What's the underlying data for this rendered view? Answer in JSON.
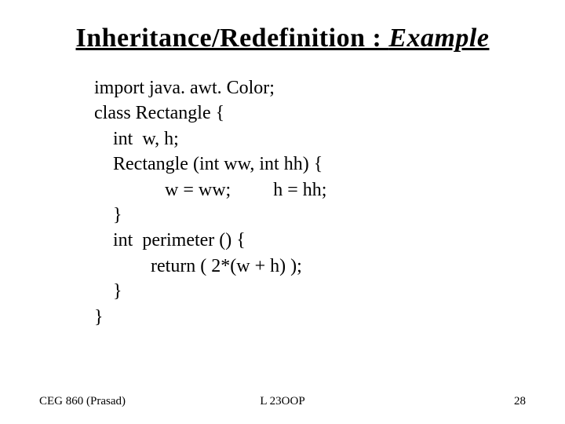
{
  "title": {
    "main": "Inheritance/Redefinition : ",
    "example": "Example"
  },
  "code": {
    "l0": "import java. awt. Color;",
    "l1": "class Rectangle {",
    "l2": "    int  w, h;",
    "l3": "    Rectangle (int ww, int hh) {",
    "l4": "               w = ww;         h = hh;",
    "l5": "    }",
    "l6": "    int  perimeter () {",
    "l7": "            return ( 2*(w + h) );",
    "l8": "    }",
    "l9": "}"
  },
  "footer": {
    "left": "CEG 860  (Prasad)",
    "center": "L 23OOP",
    "right": "28"
  }
}
